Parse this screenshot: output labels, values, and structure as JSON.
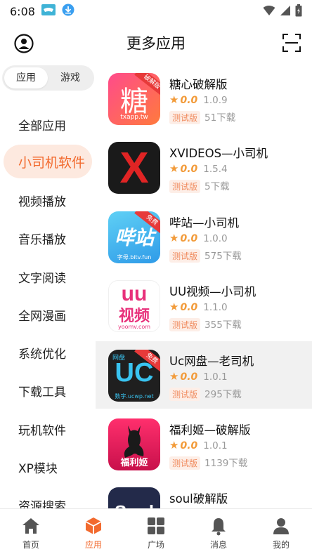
{
  "status_bar": {
    "time": "6:08"
  },
  "header": {
    "title": "更多应用"
  },
  "segment": {
    "app": "应用",
    "game": "游戏"
  },
  "categories": [
    "全部应用",
    "小司机软件",
    "视频播放",
    "音乐播放",
    "文字阅读",
    "全网漫画",
    "系统优化",
    "下载工具",
    "玩机软件",
    "XP模块",
    "资源搜索"
  ],
  "apps": [
    {
      "name": "糖心破解版",
      "score": "0.0",
      "version": "1.0.9",
      "badge": "测试版",
      "downloads": "51下载",
      "icon_text": "糖",
      "icon_sub": "txapp.tw",
      "icon_tag": "破解版"
    },
    {
      "name": "XVIDEOS—小司机",
      "score": "0.0",
      "version": "1.5.4",
      "badge": "测试版",
      "downloads": "5下载",
      "icon_text": "X"
    },
    {
      "name": "哔站—小司机",
      "score": "0.0",
      "version": "1.0.0",
      "badge": "测试版",
      "downloads": "575下载",
      "icon_text": "哔站",
      "icon_sub": "字母.bitv.fun",
      "icon_tag": "免费"
    },
    {
      "name": "UU视频—小司机",
      "score": "0.0",
      "version": "1.1.0",
      "badge": "测试版",
      "downloads": "355下载",
      "icon_text": "uu",
      "icon_text2": "视频",
      "icon_sub": "yoomv.com"
    },
    {
      "name": "Uc网盘—老司机",
      "score": "0.0",
      "version": "1.0.1",
      "badge": "测试版",
      "downloads": "295下载",
      "icon_text": "UC",
      "icon_top": "网盘",
      "icon_sub": "数字.ucwp.net",
      "icon_tag": "免费"
    },
    {
      "name": "福利姬—破解版",
      "score": "0.0",
      "version": "1.0.1",
      "badge": "测试版",
      "downloads": "1139下载",
      "icon_text": "福利姬"
    },
    {
      "name": "soul破解版",
      "icon_text": "Soul"
    }
  ],
  "bottom_nav": [
    {
      "label": "首页",
      "icon": "home-icon"
    },
    {
      "label": "应用",
      "icon": "apps-cube-icon"
    },
    {
      "label": "广场",
      "icon": "grid-icon"
    },
    {
      "label": "消息",
      "icon": "bell-icon"
    },
    {
      "label": "我的",
      "icon": "person-icon"
    }
  ],
  "colors": {
    "accent": "#f26a2e",
    "star": "#f29b3a",
    "badge_bg": "#fdeee7",
    "active_category_bg": "#fde9df"
  }
}
